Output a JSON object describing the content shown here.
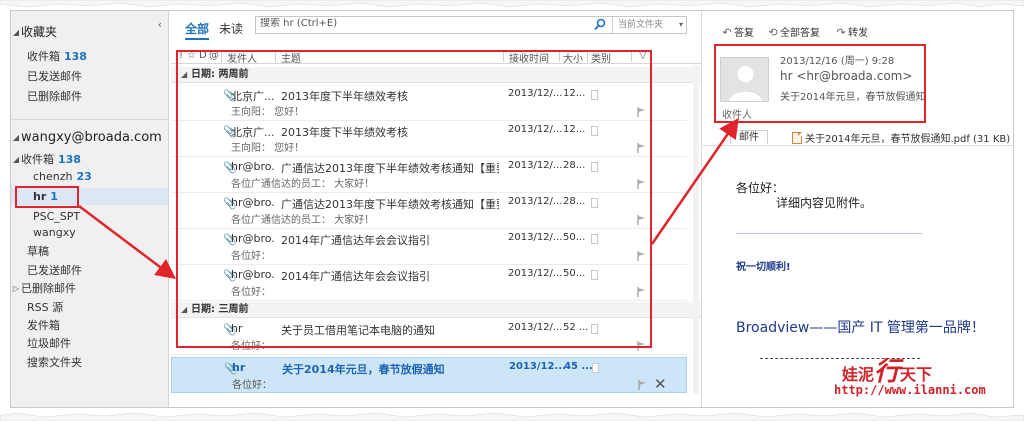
{
  "sidebar": {
    "favorites_label": "收藏夹",
    "fav_items": [
      {
        "label": "收件箱",
        "count": "138"
      },
      {
        "label": "已发送邮件",
        "count": ""
      },
      {
        "label": "已删除邮件",
        "count": ""
      }
    ],
    "account": "wangxy@broada.com",
    "inbox": {
      "label": "收件箱",
      "count": "138"
    },
    "subfolders": [
      {
        "label": "chenzh",
        "count": "23"
      },
      {
        "label": "hr",
        "count": "1"
      },
      {
        "label": "PSC_SPT",
        "count": ""
      },
      {
        "label": "wangxy",
        "count": ""
      }
    ],
    "folders": [
      "草稿",
      "已发送邮件",
      "已删除邮件",
      "RSS 源",
      "发件箱",
      "垃圾邮件",
      "搜索文件夹"
    ]
  },
  "list": {
    "filter_all": "全部",
    "filter_unread": "未读",
    "search_placeholder": "搜索 hr (Ctrl+E)",
    "search_scope": "当前文件夹",
    "columns": [
      "!",
      "☆",
      "D",
      "@",
      "发件人",
      "主题",
      "接收时间",
      "大小",
      "类别",
      "▽"
    ],
    "group1": "日期: 两周前",
    "group2": "日期: 三周前",
    "messages": [
      {
        "from": "北京广...",
        "subject": "2013年度下半年绩效考核",
        "preview": "王向阳：          您好！",
        "time": "2013/12/...",
        "size": "12..."
      },
      {
        "from": "北京广...",
        "subject": "2013年度下半年绩效考核",
        "preview": "王向阳：          您好！",
        "time": "2013/12/...",
        "size": "12..."
      },
      {
        "from": "hr@bro...",
        "subject": "广通信达2013年度下半年绩效考核通知【重要】",
        "preview": "各位广通信达的员工：     大家好！",
        "time": "2013/12/...",
        "size": "28..."
      },
      {
        "from": "hr@bro...",
        "subject": "广通信达2013年度下半年绩效考核通知【重要】",
        "preview": "各位广通信达的员工：     大家好！",
        "time": "2013/12/...",
        "size": "28..."
      },
      {
        "from": "hr@bro...",
        "subject": "2014年广通信达年会会议指引",
        "preview": "各位好：",
        "time": "2013/12/...",
        "size": "50..."
      },
      {
        "from": "hr@bro...",
        "subject": "2014年广通信达年会会议指引",
        "preview": "各位好：",
        "time": "2013/12/...",
        "size": "50..."
      },
      {
        "from": "hr",
        "subject": "关于员工借用笔记本电脑的通知",
        "preview": "各位好：",
        "time": "2013/12/...",
        "size": "52 ..."
      },
      {
        "from": "hr",
        "subject": "关于2014年元旦，春节放假通知",
        "preview": "各位好：",
        "time": "2013/12...",
        "size": "45 ..."
      }
    ]
  },
  "reading": {
    "reply": "答复",
    "reply_all": "全部答复",
    "forward": "转发",
    "date": "2013/12/16 (周一) 9:28",
    "from": "hr <hr@broada.com>",
    "subject": "关于2014年元旦，春节放假通知",
    "to_label": "收件人",
    "tab_message": "邮件",
    "attachment": "关于2014年元旦，春节放假通知.pdf (31 KB)",
    "greeting": "各位好：",
    "body_line": "详细内容见附件。",
    "wish": "祝一切顺利!",
    "brand": "Broadview——国产 IT 管理第一品牌！"
  },
  "watermark": {
    "text_left": "娃泥",
    "text_big": "行",
    "text_right": "天下",
    "url": "http://www.ilanni.com"
  },
  "colors": {
    "accent": "#1e73be",
    "annotation": "#e0242b",
    "selected_row": "#cde6f7",
    "watermark": "#d0232a"
  }
}
